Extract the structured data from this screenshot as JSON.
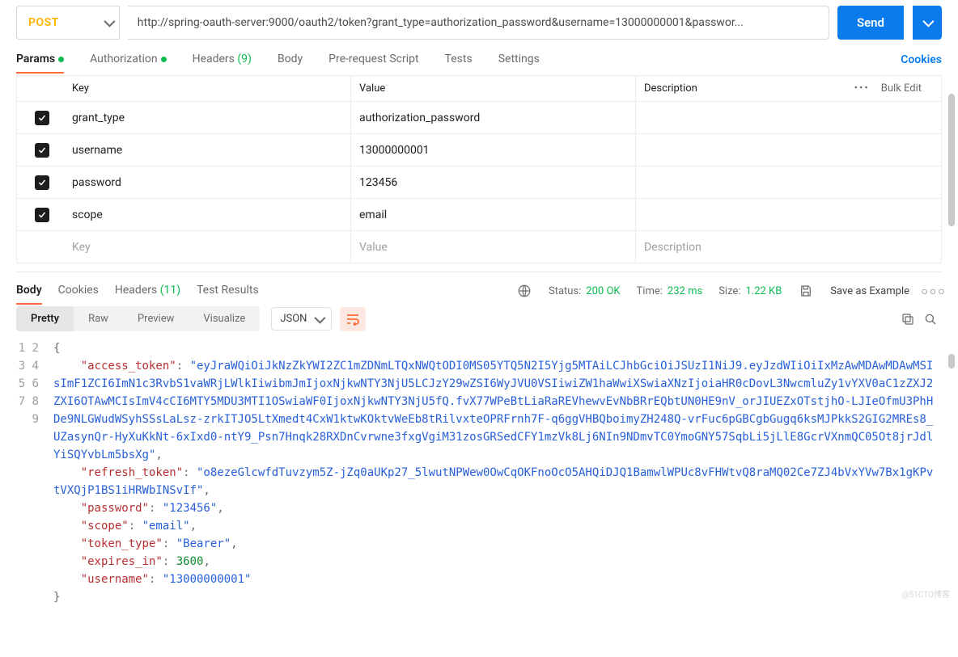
{
  "request": {
    "method": "POST",
    "url": "http://spring-oauth-server:9000/oauth2/token?grant_type=authorization_password&username=13000000001&passwor...",
    "send_label": "Send"
  },
  "reqTabs": {
    "params": "Params",
    "auth": "Authorization",
    "headers": "Headers",
    "headers_count": "(9)",
    "body": "Body",
    "prereq": "Pre-request Script",
    "tests": "Tests",
    "settings": "Settings",
    "cookies": "Cookies"
  },
  "paramsHeader": {
    "key": "Key",
    "value": "Value",
    "description": "Description",
    "bulk": "Bulk Edit"
  },
  "paramsRows": [
    {
      "key": "grant_type",
      "value": "authorization_password"
    },
    {
      "key": "username",
      "value": "13000000001"
    },
    {
      "key": "password",
      "value": "123456"
    },
    {
      "key": "scope",
      "value": "email"
    }
  ],
  "paramsPlaceholder": {
    "key": "Key",
    "value": "Value",
    "description": "Description"
  },
  "respTabs": {
    "body": "Body",
    "cookies": "Cookies",
    "headers": "Headers",
    "headers_count": "(11)",
    "tests": "Test Results"
  },
  "status": {
    "status_label": "Status:",
    "status_value": "200 OK",
    "time_label": "Time:",
    "time_value": "232 ms",
    "size_label": "Size:",
    "size_value": "1.22 KB",
    "save_example": "Save as Example"
  },
  "viewModes": {
    "pretty": "Pretty",
    "raw": "Raw",
    "preview": "Preview",
    "visualize": "Visualize",
    "format": "JSON"
  },
  "jsonBody": {
    "access_token": "eyJraWQiOiJkNzZkYWI2ZC1mZDNmLTQxNWQtODI0MS05YTQ5N2I5Yjg5MTAiLCJhbGciOiJSUzI1NiJ9.eyJzdWIiOiIxMzAwMDAwMDAwMSIsImF1ZCI6ImN1c3RvbS1vaWRjLWlkIiwibmJmIjoxNjkwNTY3NjU5LCJzY29wZSI6WyJVU0VSIiwiZW1haWwiXSwiaXNzIjoiaHR0cDovL3NwcmluZy1vYXV0aC1zZXJ2ZXI6OTAwMCIsImV4cCI6MTY5MDU3MTI1OSwiaWF0IjoxNjkwNTY3NjU5fQ.fvX77WPeBtLiaRaREVhewvEvNbBRrEQbtUN0HE9nV_orJIUEZxOTstjhO-LJIeOfmU3PhHDe9NLGWudWSyhSSsLaLsz-zrkITJO5LtXmedt4CxW1ktwKOktvWeEb8tRilvxteOPRFrnh7F-q6ggVHBQboimyZH248Q-vrFuc6pGBCgbGugq6ksMJPkkS2GIG2MREs8_UZasynQr-HyXuKkNt-6xIxd0-ntY9_Psn7Hnqk28RXDnCvrwne3fxgVgiM31zosGRSedCFY1mzVk8Lj6NIn9NDmvTC0YmoGNY57SqbLi5jLlE8GcrVXnmQC05Ot8jrJdlYiSQYvbLm5bsXg",
    "refresh_token": "o8ezeGlcwfdTuvzym5Z-jZq0aUKp27_5lwutNPWew0OwCqOKFnoOcO5AHQiDJQ1BamwlWPUc8vFHWtvQ8raMQ02Ce7ZJ4bVxYVw7Bx1gKPvtVXQjP1BS1iHRWbINSvIf",
    "password": "123456",
    "scope": "email",
    "token_type": "Bearer",
    "expires_in": 3600,
    "username": "13000000001"
  }
}
